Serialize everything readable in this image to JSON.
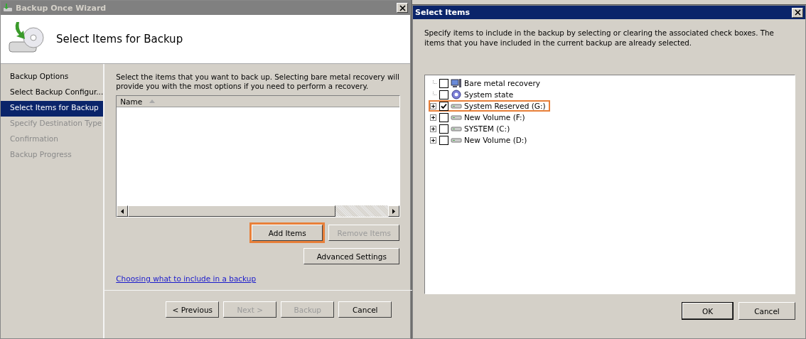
{
  "wizard": {
    "title": "Backup Once Wizard",
    "active": false,
    "heading": "Select Items for Backup",
    "steps": [
      {
        "label": "Backup Options",
        "selected": false,
        "disabled": false
      },
      {
        "label": "Select Backup Configur...",
        "selected": false,
        "disabled": false
      },
      {
        "label": "Select Items for Backup",
        "selected": true,
        "disabled": false
      },
      {
        "label": "Specify Destination Type",
        "selected": false,
        "disabled": true
      },
      {
        "label": "Confirmation",
        "selected": false,
        "disabled": true
      },
      {
        "label": "Backup Progress",
        "selected": false,
        "disabled": true
      }
    ],
    "instructions": "Select the items that you want to back up. Selecting bare metal recovery will provide you with the most options if you need to perform a recovery.",
    "list": {
      "columns": [
        "Name"
      ]
    },
    "item_buttons": [
      {
        "label": "Add Items",
        "disabled": false,
        "highlighted": true
      },
      {
        "label": "Remove Items",
        "disabled": true,
        "highlighted": false
      }
    ],
    "advanced_button": {
      "label": "Advanced Settings",
      "disabled": false
    },
    "help_link": "Choosing what to include in a backup",
    "nav_buttons": [
      {
        "label": "< Previous",
        "disabled": false
      },
      {
        "label": "Next >",
        "disabled": true
      },
      {
        "label": "Backup",
        "disabled": true
      },
      {
        "label": "Cancel",
        "disabled": false
      }
    ]
  },
  "dialog": {
    "title": "Select Items",
    "active": true,
    "description": "Specify items to include in the backup by selecting or clearing the associated check boxes. The items that you have included in the current backup are already selected.",
    "tree": [
      {
        "kind": "computer",
        "label": "Bare metal recovery",
        "checked": false,
        "highlighted": false
      },
      {
        "kind": "gear",
        "label": "System state",
        "checked": false,
        "highlighted": false
      },
      {
        "kind": "drive",
        "label": "System Reserved (G:)",
        "checked": true,
        "expanded": false,
        "highlighted": true
      },
      {
        "kind": "drive",
        "label": "New Volume (F:)",
        "checked": false,
        "expanded": false,
        "highlighted": false
      },
      {
        "kind": "drive",
        "label": "SYSTEM (C:)",
        "checked": false,
        "expanded": false,
        "highlighted": false
      },
      {
        "kind": "drive",
        "label": "New Volume (D:)",
        "checked": false,
        "expanded": false,
        "highlighted": false
      }
    ],
    "buttons": [
      {
        "label": "OK",
        "default": true
      },
      {
        "label": "Cancel",
        "default": false
      }
    ]
  }
}
